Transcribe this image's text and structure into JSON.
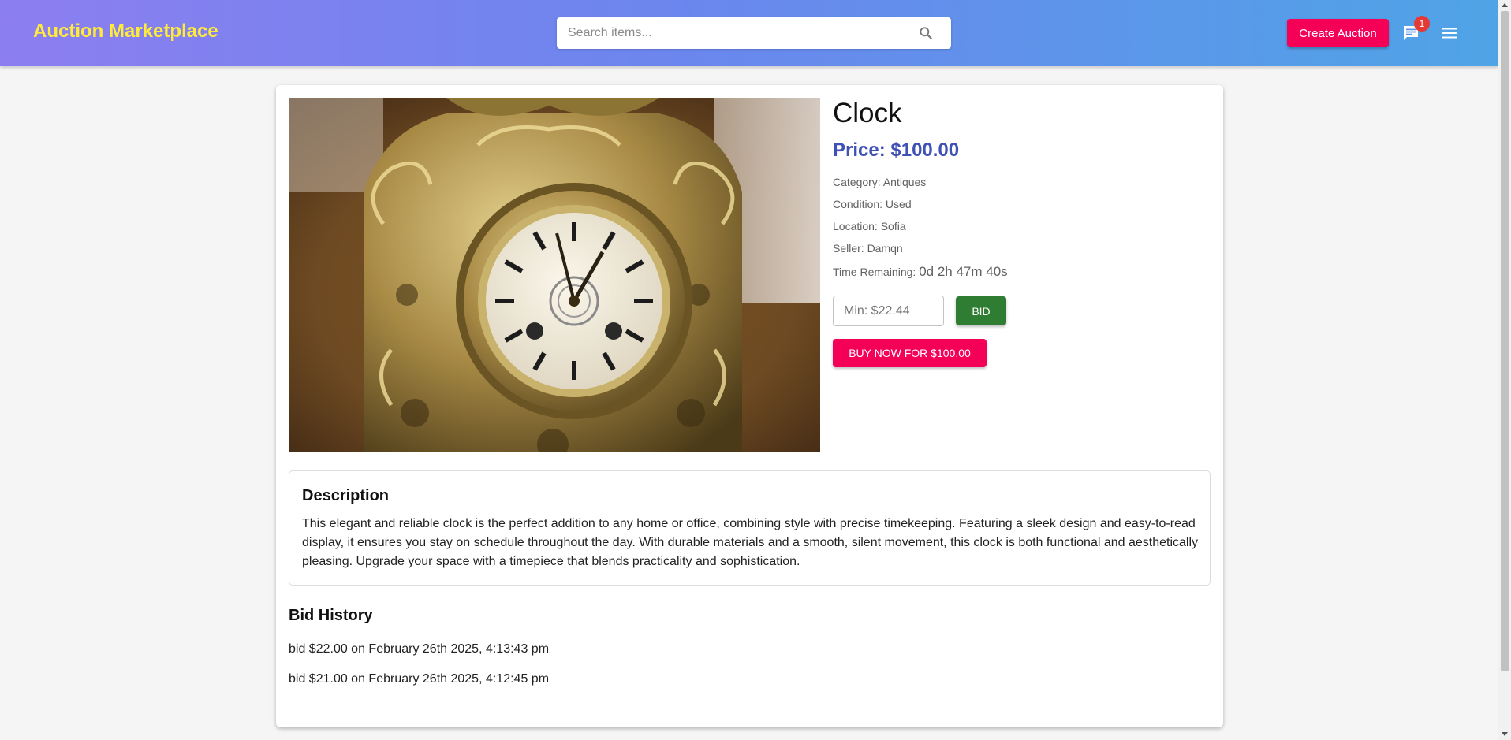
{
  "header": {
    "brand": "Auction Marketplace",
    "search_placeholder": "Search items...",
    "create_label": "Create Auction",
    "message_badge": "1"
  },
  "item": {
    "title": "Clock",
    "price": "Price: $100.00",
    "category": "Category: Antiques",
    "condition": "Condition: Used",
    "location": "Location: Sofia",
    "seller": "Seller: Damqn",
    "time_label": "Time Remaining: ",
    "time_value": "0d 2h 47m 40s",
    "bid_placeholder": "Min: $22.44",
    "bid_label": "BID",
    "buy_label": "BUY NOW FOR $100.00"
  },
  "description": {
    "title": "Description",
    "text": "This elegant and reliable clock is the perfect addition to any home or office, combining style with precise timekeeping. Featuring a sleek design and easy-to-read display, it ensures you stay on schedule throughout the day. With durable materials and a smooth, silent movement, this clock is both functional and aesthetically pleasing. Upgrade your space with a timepiece that blends practicality and sophistication."
  },
  "bid_history": {
    "title": "Bid History",
    "entries": [
      "bid $22.00 on February 26th 2025, 4:13:43 pm",
      "bid $21.00 on February 26th 2025, 4:12:45 pm"
    ]
  },
  "colors": {
    "brand": "#ffeb3b",
    "accent_pink": "#f50057",
    "bid_green": "#2e7d32",
    "price_blue": "#3f51b5"
  },
  "icons": {
    "search": "search-icon",
    "messages": "message-icon",
    "menu": "menu-icon"
  }
}
